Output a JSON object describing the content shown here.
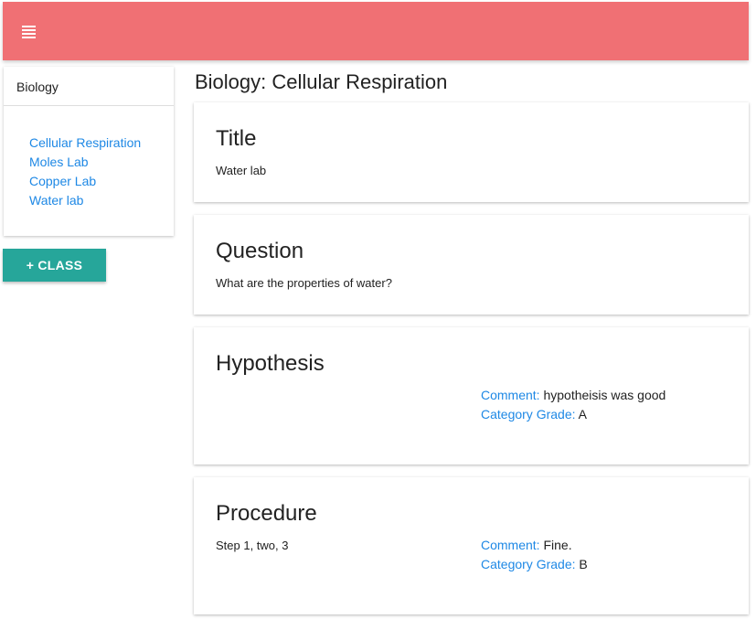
{
  "header": {
    "menu_icon": "hamburger-menu-icon",
    "bar_color": "#f07074"
  },
  "sidebar": {
    "heading": "Biology",
    "items": [
      "Cellular Respiration",
      "Moles Lab",
      "Copper Lab",
      "Water lab"
    ],
    "add_button": "+ CLASS",
    "link_color": "#1e88e5",
    "button_color": "#26a69a"
  },
  "main": {
    "page_title": "Biology: Cellular Respiration",
    "sections": {
      "title": {
        "heading": "Title",
        "text": "Water lab"
      },
      "question": {
        "heading": "Question",
        "text": "What are the properties of water?"
      },
      "hypothesis": {
        "heading": "Hypothesis",
        "text": "",
        "comment_label": "Comment:",
        "comment": "hypotheisis was good",
        "grade_label": "Category Grade:",
        "grade": "A"
      },
      "procedure": {
        "heading": "Procedure",
        "text": "Step 1, two, 3",
        "comment_label": "Comment:",
        "comment": "Fine.",
        "grade_label": "Category Grade:",
        "grade": "B"
      }
    }
  }
}
